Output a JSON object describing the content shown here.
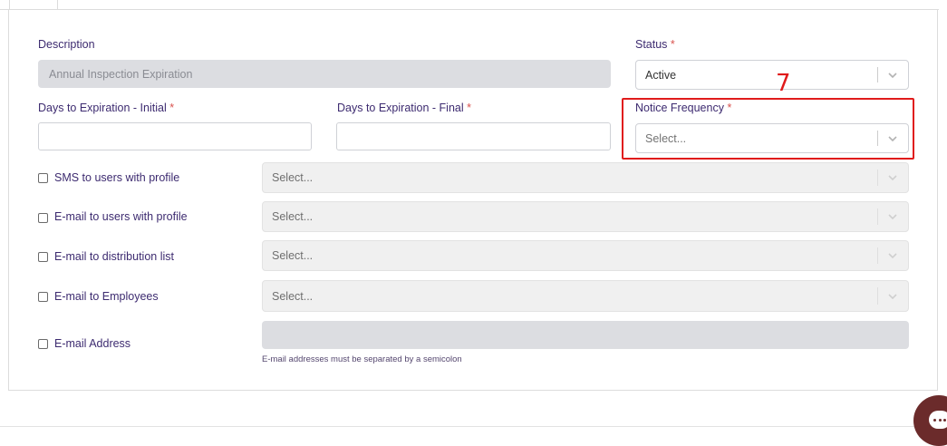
{
  "form": {
    "description": {
      "label": "Description",
      "value": "Annual Inspection Expiration"
    },
    "status": {
      "label": "Status",
      "required_mark": "*",
      "value": "Active"
    },
    "days_initial": {
      "label": "Days to Expiration - Initial",
      "required_mark": "*",
      "value": ""
    },
    "days_final": {
      "label": "Days to Expiration - Final",
      "required_mark": "*",
      "value": ""
    },
    "notice_frequency": {
      "label": "Notice Frequency",
      "required_mark": "*",
      "placeholder": "Select..."
    },
    "notifications": [
      {
        "label": "SMS to users with profile",
        "checked": false,
        "placeholder": "Select..."
      },
      {
        "label": "E-mail to users with profile",
        "checked": false,
        "placeholder": "Select..."
      },
      {
        "label": "E-mail to distribution list",
        "checked": false,
        "placeholder": "Select..."
      },
      {
        "label": "E-mail to Employees",
        "checked": false,
        "placeholder": "Select..."
      }
    ],
    "email_address": {
      "label": "E-mail Address",
      "checked": false,
      "value": "",
      "help": "E-mail addresses must be separated by a semicolon"
    }
  },
  "annotation": {
    "number": "7",
    "color": "#e01b1b"
  },
  "colors": {
    "label": "#3d2b70",
    "required": "#d9534f",
    "chat_button": "#6b2b2b"
  },
  "icons": {
    "select_arrow": "chevron-down-icon",
    "chat": "chat-bubble-icon"
  }
}
